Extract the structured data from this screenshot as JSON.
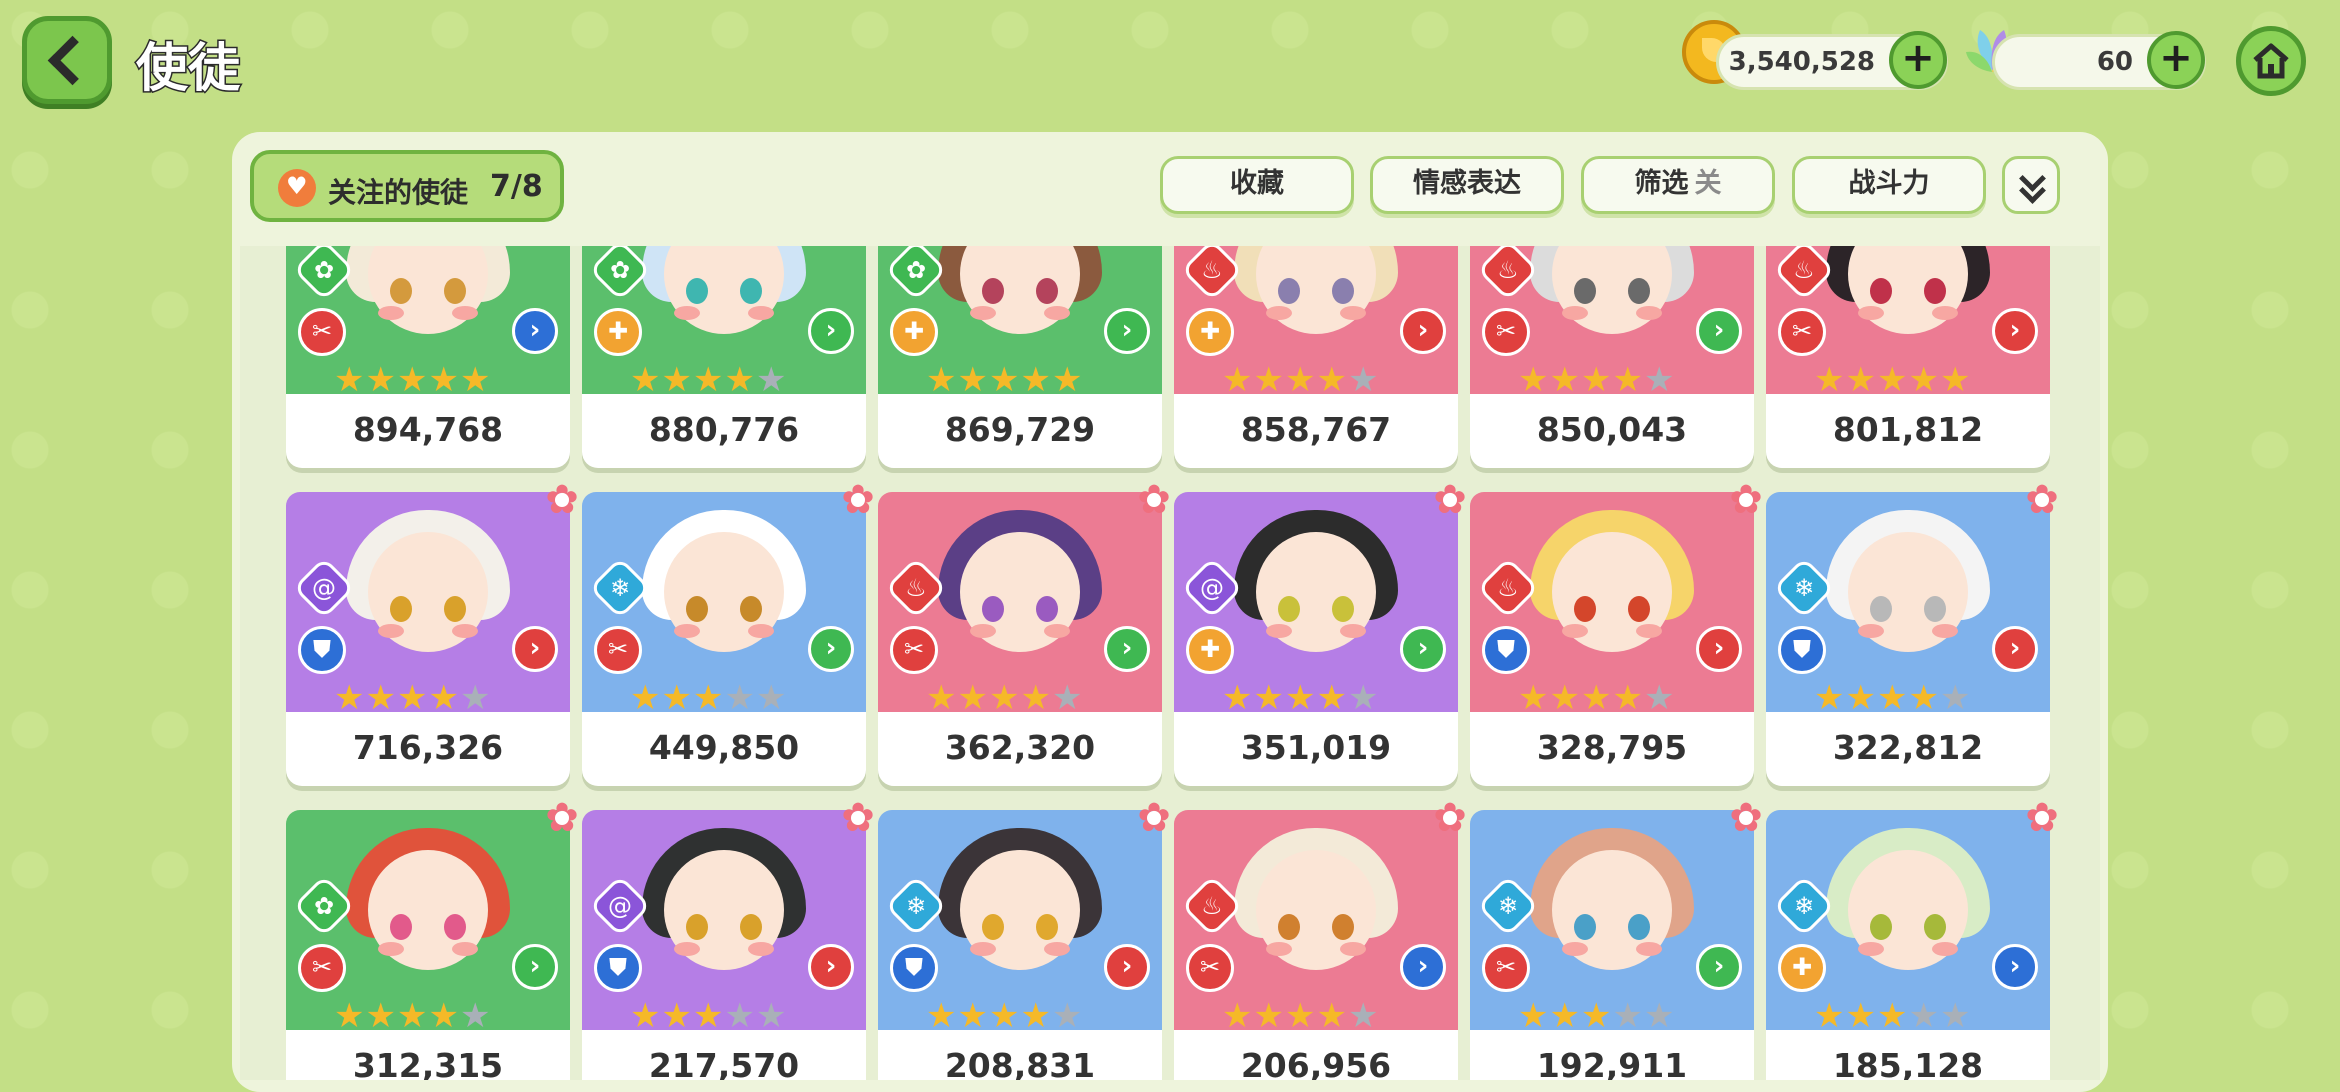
{
  "header": {
    "title": "使徒",
    "gold": "3,540,528",
    "gems": "60"
  },
  "toolbar": {
    "follow_label": "关注的使徒",
    "follow_count": "7/8",
    "collect": "收藏",
    "emote": "情感表达",
    "filter": "筛选",
    "filter_state": "关",
    "power": "战斗力"
  },
  "colors": {
    "green": "#5bbf6c",
    "blue": "#7fb2ec",
    "pink": "#ec7b93",
    "purple": "#b57ee6",
    "star": "#f5b928",
    "star_empty": "#a9b0b8"
  },
  "rows": [
    [
      {
        "power": "894,768",
        "bg": "green",
        "elem": "wind",
        "cls": "attack",
        "role": "blue",
        "stars": 5,
        "hair": "#f3ead8",
        "eye": "#d49a3d",
        "flower": false
      },
      {
        "power": "880,776",
        "bg": "green",
        "elem": "wind",
        "cls": "support",
        "role": "green",
        "stars": 4,
        "hair": "#cfe4f6",
        "eye": "#3fb6b0",
        "flower": false
      },
      {
        "power": "869,729",
        "bg": "green",
        "elem": "wind",
        "cls": "support",
        "role": "green",
        "stars": 5,
        "hair": "#8b5a3e",
        "eye": "#b4435c",
        "flower": false
      },
      {
        "power": "858,767",
        "bg": "pink",
        "elem": "fire",
        "cls": "support",
        "role": "red",
        "stars": 4,
        "hair": "#f1dfb8",
        "eye": "#8a7fae",
        "flower": false
      },
      {
        "power": "850,043",
        "bg": "pink",
        "elem": "fire",
        "cls": "attack",
        "role": "green",
        "stars": 4,
        "hair": "#dcdcdc",
        "eye": "#6a6a6a",
        "flower": false
      },
      {
        "power": "801,812",
        "bg": "pink",
        "elem": "fire",
        "cls": "attack",
        "role": "red",
        "stars": 5,
        "hair": "#2c2428",
        "eye": "#c0314a",
        "flower": false
      }
    ],
    [
      {
        "power": "716,326",
        "bg": "purple",
        "elem": "void",
        "cls": "defense",
        "role": "red",
        "stars": 4,
        "hair": "#f3f0ea",
        "eye": "#d9a12b",
        "flower": true
      },
      {
        "power": "449,850",
        "bg": "blue",
        "elem": "ice",
        "cls": "attack",
        "role": "green",
        "stars": 3,
        "hair": "#ffffff",
        "eye": "#c78a2a",
        "flower": true
      },
      {
        "power": "362,320",
        "bg": "pink",
        "elem": "fire",
        "cls": "attack",
        "role": "green",
        "stars": 4,
        "hair": "#5b3f86",
        "eye": "#9a5bc0",
        "flower": true
      },
      {
        "power": "351,019",
        "bg": "purple",
        "elem": "void",
        "cls": "support",
        "role": "green",
        "stars": 4,
        "hair": "#2c2c2c",
        "eye": "#c9c13a",
        "flower": true
      },
      {
        "power": "328,795",
        "bg": "pink",
        "elem": "fire",
        "cls": "defense",
        "role": "red",
        "stars": 4,
        "hair": "#f6d46a",
        "eye": "#d4462b",
        "flower": true
      },
      {
        "power": "322,812",
        "bg": "blue",
        "elem": "ice",
        "cls": "defense",
        "role": "red",
        "stars": 4,
        "hair": "#f4f4f4",
        "eye": "#b8b8b8",
        "flower": true
      }
    ],
    [
      {
        "power": "312,315",
        "bg": "green",
        "elem": "wind",
        "cls": "attack",
        "role": "green",
        "stars": 4,
        "hair": "#e0533b",
        "eye": "#e25a8b",
        "flower": true
      },
      {
        "power": "217,570",
        "bg": "purple",
        "elem": "void",
        "cls": "defense",
        "role": "red",
        "stars": 3,
        "hair": "#2f3131",
        "eye": "#d9a12b",
        "flower": true
      },
      {
        "power": "208,831",
        "bg": "blue",
        "elem": "ice",
        "cls": "defense",
        "role": "red",
        "stars": 4,
        "hair": "#3b3438",
        "eye": "#e0a82e",
        "flower": true
      },
      {
        "power": "206,956",
        "bg": "pink",
        "elem": "fire",
        "cls": "attack",
        "role": "blue",
        "stars": 4,
        "hair": "#f3ead8",
        "eye": "#d0802f",
        "flower": true
      },
      {
        "power": "192,911",
        "bg": "blue",
        "elem": "ice",
        "cls": "attack",
        "role": "green",
        "stars": 3,
        "hair": "#e0a48a",
        "eye": "#4aa0c8",
        "flower": true
      },
      {
        "power": "185,128",
        "bg": "blue",
        "elem": "ice",
        "cls": "support",
        "role": "blue",
        "stars": 3,
        "hair": "#d8ecc6",
        "eye": "#a6b93a",
        "flower": true
      }
    ]
  ]
}
